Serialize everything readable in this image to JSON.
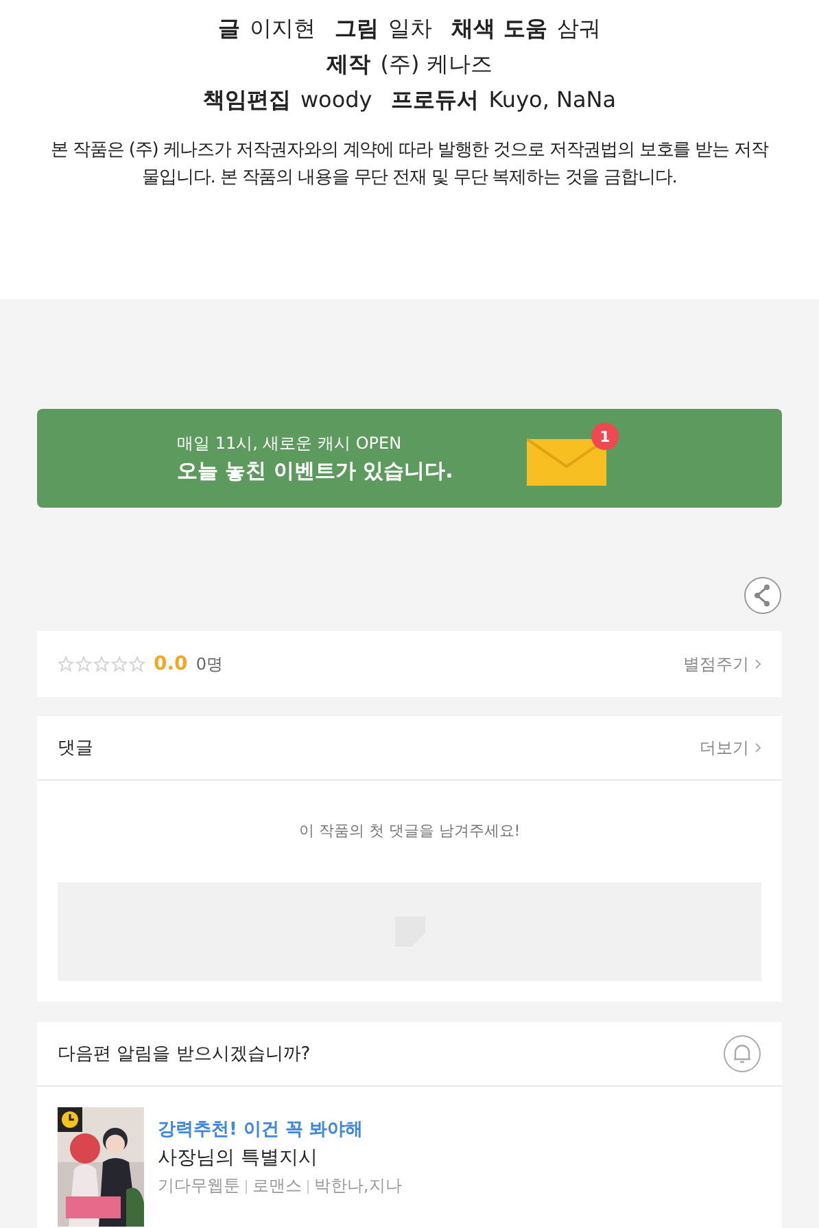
{
  "credits": [
    [
      {
        "role": "글",
        "name": "이지현"
      },
      {
        "role": "그림",
        "name": "일차"
      },
      {
        "role": "채색 도움",
        "name": "삼궈"
      }
    ],
    [
      {
        "role": "제작",
        "name": "(주) 케나즈"
      }
    ],
    [
      {
        "role": "책임편집",
        "name": "woody"
      },
      {
        "role": "프로듀서",
        "name": "Kuyo, NaNa"
      }
    ]
  ],
  "notice": "본 작품은 (주) 케나즈가 저작권자와의 계약에 따라 발행한 것으로 저작권법의 보호를 받는 저작물입니다. 본 작품의 내용을 무단 전재 및 무단 복제하는 것을 금합니다.",
  "banner": {
    "line1": "매일 11시, 새로운 캐시 OPEN",
    "line2": "오늘 놓친 이벤트가 있습니다.",
    "badge": "1"
  },
  "rating": {
    "stars": 0,
    "score": "0.0",
    "count": "0명",
    "action": "별점주기"
  },
  "comments": {
    "title": "댓글",
    "more": "더보기",
    "empty": "이 작품의 첫 댓글을 남겨주세요!"
  },
  "alert": {
    "question": "다음편 알림을 받으시겠습니까?"
  },
  "recommend": {
    "tag": "강력추천! 이건 꼭 봐야해",
    "title": "사장님의 특별지시",
    "meta": [
      "기다무웹툰",
      "로맨스",
      "박한나,지나"
    ]
  }
}
